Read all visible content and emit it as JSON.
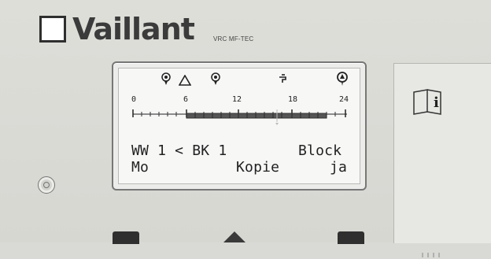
{
  "brand": {
    "name": "Vaillant",
    "model": "VRC MF-TEC"
  },
  "display": {
    "status_icons": [
      "sensor-1-icon",
      "warning-triangle-icon",
      "sensor-2-icon",
      "tap-icon",
      "radiator-icon"
    ],
    "time_marks": [
      "0",
      "6",
      "12",
      "18",
      "24"
    ],
    "line1": {
      "left": "WW 1 < BK 1",
      "right": "Block"
    },
    "line2": {
      "left": "Mo",
      "right": "Kopie",
      "far_right": "ja"
    }
  },
  "controls": {
    "left_button_icon": "rotary-knob-icon",
    "right_info_icon": "book-info-icon"
  }
}
